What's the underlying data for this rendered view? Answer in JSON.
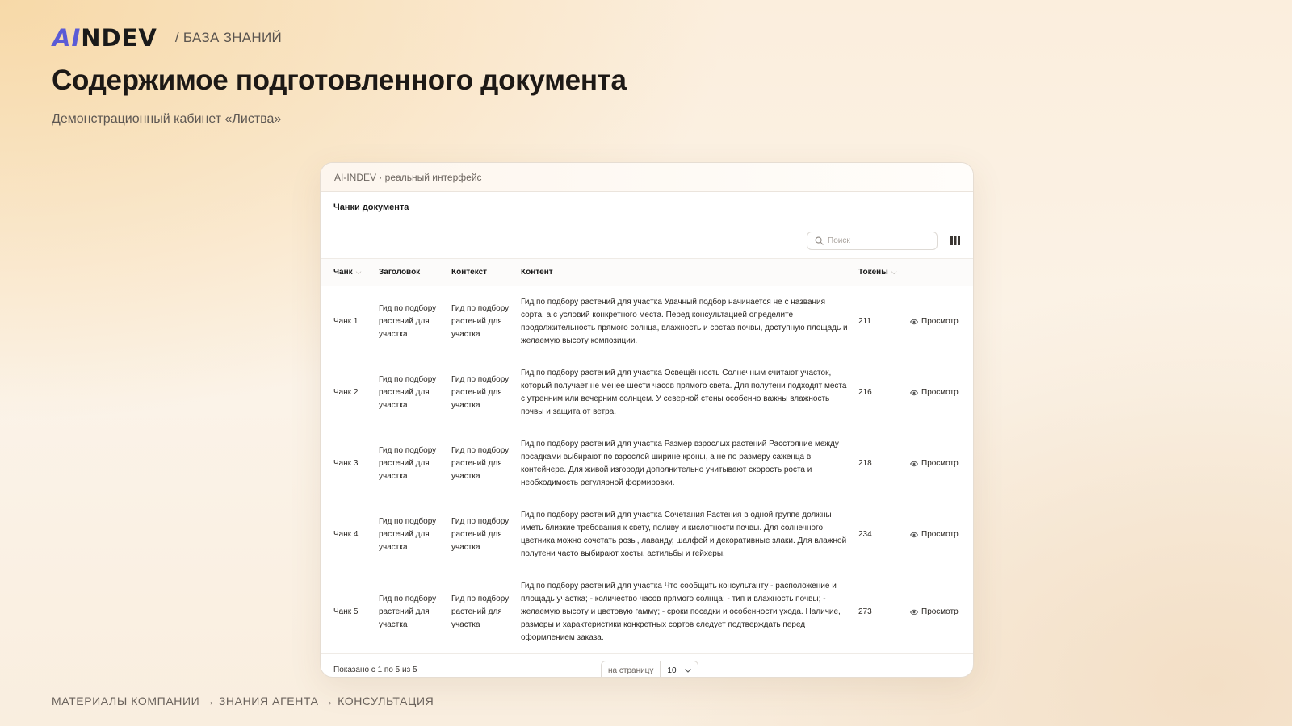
{
  "header": {
    "logo_ai": "AI",
    "logo_rest": "NDEV",
    "breadcrumb": "/ БАЗА ЗНАНИЙ",
    "title": "Содержимое подготовленного документа",
    "subtitle": "Демонстрационный кабинет «Листва»"
  },
  "window": {
    "bar_title": "AI-INDEV · реальный интерфейс",
    "section_title": "Чанки документа",
    "search_placeholder": "Поиск",
    "columns": {
      "chunk": "Чанк",
      "heading": "Заголовок",
      "context": "Контекст",
      "content": "Контент",
      "tokens": "Токены"
    },
    "rows": [
      {
        "chunk": "Чанк 1",
        "heading": "Гид по подбору растений для участка",
        "context": "Гид по подбору растений для участка",
        "content": "Гид по подбору растений для участка Удачный подбор начинается не с названия сорта, а с условий конкретного места. Перед консультацией определите продолжительность прямого солнца, влажность и состав почвы, доступную площадь и желаемую высоту композиции.",
        "tokens": "211",
        "action": "Просмотр"
      },
      {
        "chunk": "Чанк 2",
        "heading": "Гид по подбору растений для участка",
        "context": "Гид по подбору растений для участка",
        "content": "Гид по подбору растений для участка Освещённость Солнечным считают участок, который получает не менее шести часов прямого света. Для полутени подходят места с утренним или вечерним солнцем. У северной стены особенно важны влажность почвы и защита от ветра.",
        "tokens": "216",
        "action": "Просмотр"
      },
      {
        "chunk": "Чанк 3",
        "heading": "Гид по подбору растений для участка",
        "context": "Гид по подбору растений для участка",
        "content": "Гид по подбору растений для участка Размер взрослых растений Расстояние между посадками выбирают по взрослой ширине кроны, а не по размеру саженца в контейнере. Для живой изгороди дополнительно учитывают скорость роста и необходимость регулярной формировки.",
        "tokens": "218",
        "action": "Просмотр"
      },
      {
        "chunk": "Чанк 4",
        "heading": "Гид по подбору растений для участка",
        "context": "Гид по подбору растений для участка",
        "content": "Гид по подбору растений для участка Сочетания Растения в одной группе должны иметь близкие требования к свету, поливу и кислотности почвы. Для солнечного цветника можно сочетать розы, лаванду, шалфей и декоративные злаки. Для влажной полутени часто выбирают хосты, астильбы и гейхеры.",
        "tokens": "234",
        "action": "Просмотр"
      },
      {
        "chunk": "Чанк 5",
        "heading": "Гид по подбору растений для участка",
        "context": "Гид по подбору растений для участка",
        "content": "Гид по подбору растений для участка Что сообщить консультанту - расположение и площадь участка; - количество часов прямого солнца; - тип и влажность почвы; - желаемую высоту и цветовую гамму; - сроки посадки и особенности ухода. Наличие, размеры и характеристики конкретных сортов следует подтверждать перед оформлением заказа.",
        "tokens": "273",
        "action": "Просмотр"
      }
    ],
    "footer_shown": "Показано с 1 по 5 из 5",
    "per_page_label": "на страницу",
    "per_page_value": "10"
  },
  "footer": "МАТЕРИАЛЫ КОМПАНИИ → ЗНАНИЯ АГЕНТА → КОНСУЛЬТАЦИЯ",
  "colors": {
    "logo_accent": "#5b5bd6",
    "background_warm": "#f7d9a8"
  }
}
